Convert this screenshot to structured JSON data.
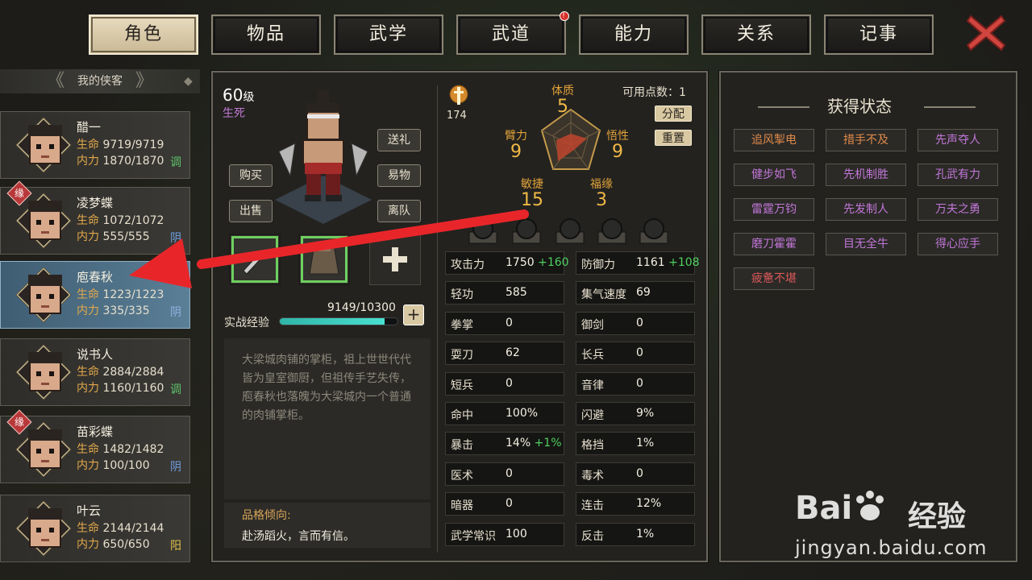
{
  "tabs": [
    {
      "label": "角色",
      "active": true
    },
    {
      "label": "物品"
    },
    {
      "label": "武学"
    },
    {
      "label": "武道",
      "badge": "!"
    },
    {
      "label": "能力"
    },
    {
      "label": "关系"
    },
    {
      "label": "记事"
    }
  ],
  "list_title": "我的侠客",
  "characters": [
    {
      "name": "醋一",
      "hp_label": "生命",
      "hp": "9719/9719",
      "mp_label": "内力",
      "mp": "1870/1870",
      "tag": "调",
      "tag_color": "#5fc46a",
      "fate": ""
    },
    {
      "name": "凌梦蝶",
      "hp_label": "生命",
      "hp": "1072/1072",
      "mp_label": "内力",
      "mp": "555/555",
      "tag": "阴",
      "tag_color": "#6f9ee0",
      "fate": "缘"
    },
    {
      "name": "庖春秋",
      "hp_label": "生命",
      "hp": "1223/1223",
      "mp_label": "内力",
      "mp": "335/335",
      "tag": "阴",
      "tag_color": "#8fb2e0",
      "fate": "",
      "selected": true
    },
    {
      "name": "说书人",
      "hp_label": "生命",
      "hp": "2884/2884",
      "mp_label": "内力",
      "mp": "1160/1160",
      "tag": "调",
      "tag_color": "#5fc46a",
      "fate": ""
    },
    {
      "name": "苗彩蝶",
      "hp_label": "生命",
      "hp": "1482/1482",
      "mp_label": "内力",
      "mp": "100/100",
      "tag": "阴",
      "tag_color": "#6f9ee0",
      "fate": "缘"
    },
    {
      "name": "叶云",
      "hp_label": "生命",
      "hp": "2144/2144",
      "mp_label": "内力",
      "mp": "650/650",
      "tag": "阳",
      "tag_color": "#e0c04a",
      "fate": ""
    }
  ],
  "hero": {
    "level": "60",
    "level_unit": "级",
    "status": "生死",
    "buttons": {
      "gift": "送礼",
      "buy": "购买",
      "trade": "易物",
      "sell": "出售",
      "leave": "离队"
    },
    "exp_label": "实战经验",
    "exp_value": "9149/10300",
    "exp_fraction": 0.888,
    "description": "大梁城肉铺的掌柜，祖上世世代代皆为皇室御厨，但祖传手艺失传，庖春秋也落魄为大梁城内一个普通的肉铺掌柜。",
    "trait_title": "品格倾向:",
    "trait_text": "赴汤蹈火，言而有信。"
  },
  "power": "174",
  "attributes": {
    "points_label": "可用点数：1",
    "allocate": "分配",
    "reset": "重置",
    "constitution": {
      "label": "体质",
      "value": "5"
    },
    "strength": {
      "label": "臂力",
      "value": "9"
    },
    "insight": {
      "label": "悟性",
      "value": "9"
    },
    "agility": {
      "label": "敏捷",
      "value": "15"
    },
    "luck": {
      "label": "福缘",
      "value": "3"
    }
  },
  "stats": [
    {
      "k": "攻击力",
      "v": "1750",
      "plus": "+160"
    },
    {
      "k": "防御力",
      "v": "1161",
      "plus": "+108"
    },
    {
      "k": "轻功",
      "v": "585"
    },
    {
      "k": "集气速度",
      "v": "69"
    },
    {
      "k": "拳掌",
      "v": "0"
    },
    {
      "k": "御剑",
      "v": "0"
    },
    {
      "k": "耍刀",
      "v": "62"
    },
    {
      "k": "长兵",
      "v": "0"
    },
    {
      "k": "短兵",
      "v": "0"
    },
    {
      "k": "音律",
      "v": "0"
    },
    {
      "k": "命中",
      "v": "100%"
    },
    {
      "k": "闪避",
      "v": "9%"
    },
    {
      "k": "暴击",
      "v": "14%",
      "plus": "+1%"
    },
    {
      "k": "格挡",
      "v": "1%"
    },
    {
      "k": "医术",
      "v": "0"
    },
    {
      "k": "毒术",
      "v": "0"
    },
    {
      "k": "暗器",
      "v": "0"
    },
    {
      "k": "连击",
      "v": "12%"
    },
    {
      "k": "武学常识",
      "v": "100"
    },
    {
      "k": "反击",
      "v": "1%"
    }
  ],
  "status_panel": {
    "title": "获得状态",
    "buffs": [
      {
        "label": "追风掣电",
        "color": "#e08a4a"
      },
      {
        "label": "措手不及",
        "color": "#e08a4a"
      },
      {
        "label": "先声夺人",
        "color": "#c277d8"
      },
      {
        "label": "健步如飞",
        "color": "#c277d8"
      },
      {
        "label": "先机制胜",
        "color": "#c277d8"
      },
      {
        "label": "孔武有力",
        "color": "#c277d8"
      },
      {
        "label": "雷霆万钧",
        "color": "#c277d8"
      },
      {
        "label": "先发制人",
        "color": "#c277d8"
      },
      {
        "label": "万夫之勇",
        "color": "#c277d8"
      },
      {
        "label": "磨刀霍霍",
        "color": "#c277d8"
      },
      {
        "label": "目无全牛",
        "color": "#c277d8"
      },
      {
        "label": "得心应手",
        "color": "#c277d8"
      },
      {
        "label": "疲惫不堪",
        "color": "#d85858"
      }
    ]
  },
  "watermark": {
    "brand": "Bai",
    "brand2": "经验",
    "url": "jingyan.baidu.com"
  }
}
